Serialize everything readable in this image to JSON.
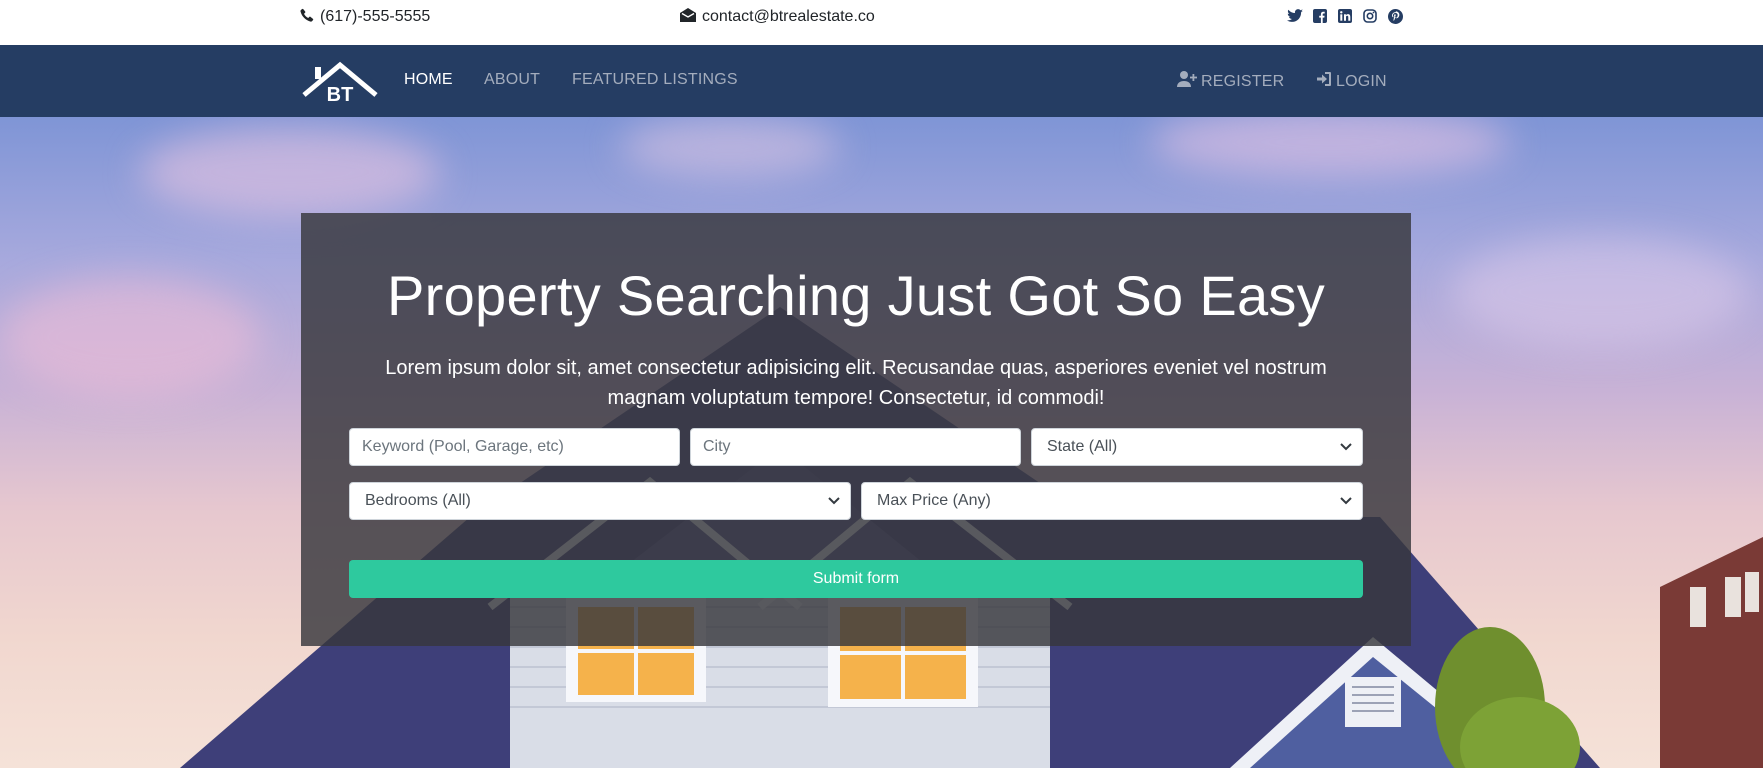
{
  "topbar": {
    "phone": "(617)-555-5555",
    "email": "contact@btrealestate.co",
    "phone_icon": "phone-icon",
    "email_icon": "envelope-icon",
    "social_icons": [
      "twitter-icon",
      "facebook-icon",
      "linkedin-icon",
      "instagram-icon",
      "pinterest-icon"
    ]
  },
  "navbar": {
    "logo_text": "BT",
    "links": [
      "HOME",
      "ABOUT",
      "FEATURED LISTINGS"
    ],
    "register": "REGISTER",
    "login": "LOGIN",
    "active": "HOME"
  },
  "hero": {
    "title": "Property Searching Just Got So Easy",
    "lead": "Lorem ipsum dolor sit, amet consectetur adipisicing elit. Recusandae quas, asperiores eveniet vel nostrum magnam voluptatum tempore! Consectetur, id commodi!"
  },
  "search_form": {
    "keyword_placeholder": "Keyword (Pool, Garage, etc)",
    "city_placeholder": "City",
    "state_selected": "State (All)",
    "bedrooms_selected": "Bedrooms (All)",
    "max_price_selected": "Max Price (Any)",
    "submit_label": "Submit form"
  },
  "colors": {
    "navbar_bg": "#253d63",
    "submit_bg": "#2ec99e",
    "panel_bg": "rgba(55,55,60,0.82)"
  }
}
